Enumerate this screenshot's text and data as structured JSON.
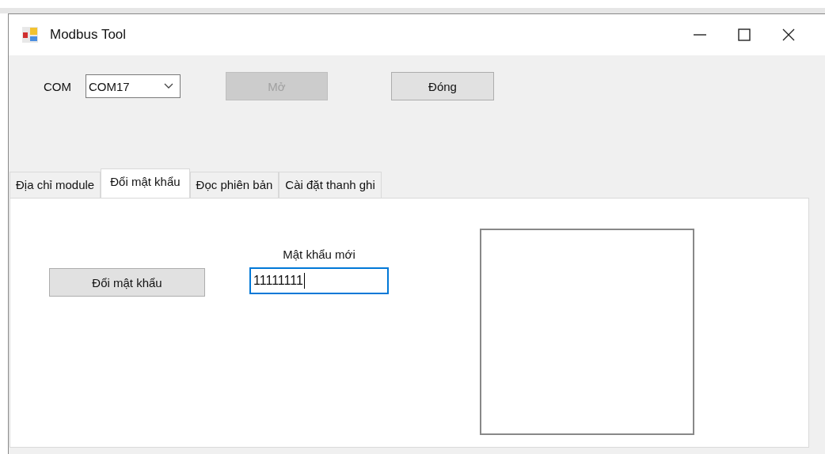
{
  "window": {
    "title": "Modbus Tool"
  },
  "connection": {
    "label": "COM",
    "port": "COM17",
    "buttons": [
      {
        "label": "Mở",
        "disabled": true
      },
      {
        "label": "Đóng",
        "disabled": false
      }
    ]
  },
  "tabs": [
    {
      "label": "Địa chỉ module",
      "selected": false
    },
    {
      "label": "Đổi mật khẩu",
      "selected": true
    },
    {
      "label": "Đọc phiên bản",
      "selected": false
    },
    {
      "label": "Cài đặt thanh ghi",
      "selected": false
    }
  ],
  "password_tab": {
    "button": "Đổi mật khẩu",
    "field_label": "Mật khẩu mới",
    "value": "11111111",
    "focused": true
  }
}
